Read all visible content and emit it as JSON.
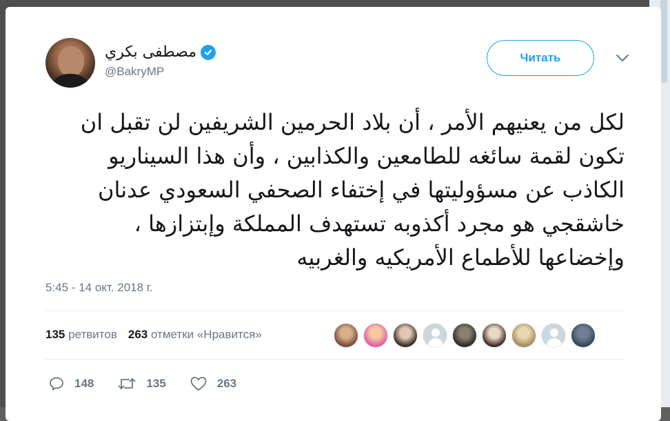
{
  "tweet": {
    "author": {
      "display_name": "مصطفى بكري",
      "handle": "@BakryMP",
      "verified": true
    },
    "follow_label": "Читать",
    "menu_icon": "chevron-down-icon",
    "text": "لكل من يعنيهم الأمر ، أن بلاد الحرمين الشريفين لن تقبل ان\nتكون لقمة سائغه للطامعين والكذابين ، وأن هذا السيناريو\nالكاذب عن مسؤوليتها في إختفاء الصحفي السعودي عدنان\nخاشقجي هو مجرد أكذوبه تستهدف المملكة وإبتزازها ،\nوإخضاعها للأطماع الأمريكيه والغربيه",
    "timestamp": "5:45 - 14 окт. 2018 г.",
    "stats": {
      "retweets_count": "135",
      "retweets_label": "ретвитов",
      "likes_count": "263",
      "likes_label": "отметки «Нравится»"
    },
    "likers": [
      {
        "kind": "photo",
        "color_a": "#7a4a3a",
        "color_b": "#d9b08c"
      },
      {
        "kind": "photo",
        "color_a": "#e05da8",
        "color_b": "#f6c9a0"
      },
      {
        "kind": "photo",
        "color_a": "#3b2a22",
        "color_b": "#e2c7b3"
      },
      {
        "kind": "default"
      },
      {
        "kind": "photo",
        "color_a": "#2a2a2a",
        "color_b": "#8a8070"
      },
      {
        "kind": "photo",
        "color_a": "#3d2b22",
        "color_b": "#e8d9c4"
      },
      {
        "kind": "photo",
        "color_a": "#a88a5a",
        "color_b": "#e8d8b0"
      },
      {
        "kind": "default"
      },
      {
        "kind": "photo",
        "color_a": "#35465c",
        "color_b": "#6f7f94"
      }
    ],
    "actions": {
      "replies": "148",
      "retweets": "135",
      "likes": "263"
    },
    "colors": {
      "accent": "#1da1f2",
      "text": "#14171a",
      "muted": "#657786"
    }
  }
}
